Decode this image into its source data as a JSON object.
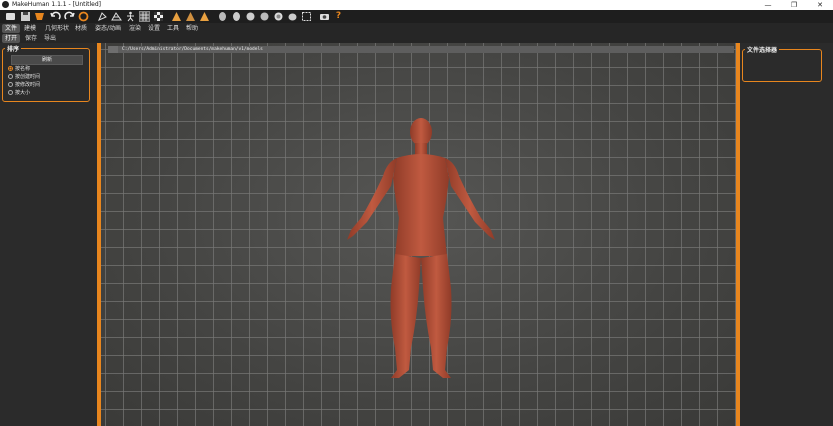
{
  "window": {
    "title": "MakeHuman 1.1.1 - [Untitled]",
    "minimize": "—",
    "maximize": "❐",
    "close": "✕"
  },
  "toolbar": {
    "icons": [
      "image-icon",
      "save-icon",
      "export-icon",
      "undo-icon",
      "redo-icon",
      "reset-icon",
      "smooth-icon",
      "wireframe-icon",
      "pose-icon",
      "grid-icon",
      "checker-icon",
      "front-view-icon",
      "side-view-icon",
      "back-view-icon",
      "top-view-icon",
      "bottom-view-icon",
      "left-view-icon",
      "right-view-icon",
      "reset-camera-icon",
      "zoom-icon",
      "screenshot-icon",
      "help-icon"
    ],
    "help_glyph": "?"
  },
  "menu": {
    "tabs": [
      "文件",
      "建模",
      "几何形状",
      "材质",
      "姿态/动画",
      "渲染",
      "设置",
      "工具",
      "帮助"
    ],
    "active": 0
  },
  "subtabs": {
    "tabs": [
      "打开",
      "保存",
      "导出"
    ],
    "active": 0
  },
  "sort": {
    "legend": "排序",
    "refresh_label": "刷新",
    "options": [
      "按名称",
      "按创建时间",
      "按修改时间",
      "按大小"
    ],
    "selected": 0
  },
  "path": {
    "value": "C:/Users/Administrator/Documents/makehuman/v1/models"
  },
  "filter": {
    "legend": "文件选择器"
  },
  "colors": {
    "accent": "#e8861e",
    "skin": "#b5533c"
  }
}
